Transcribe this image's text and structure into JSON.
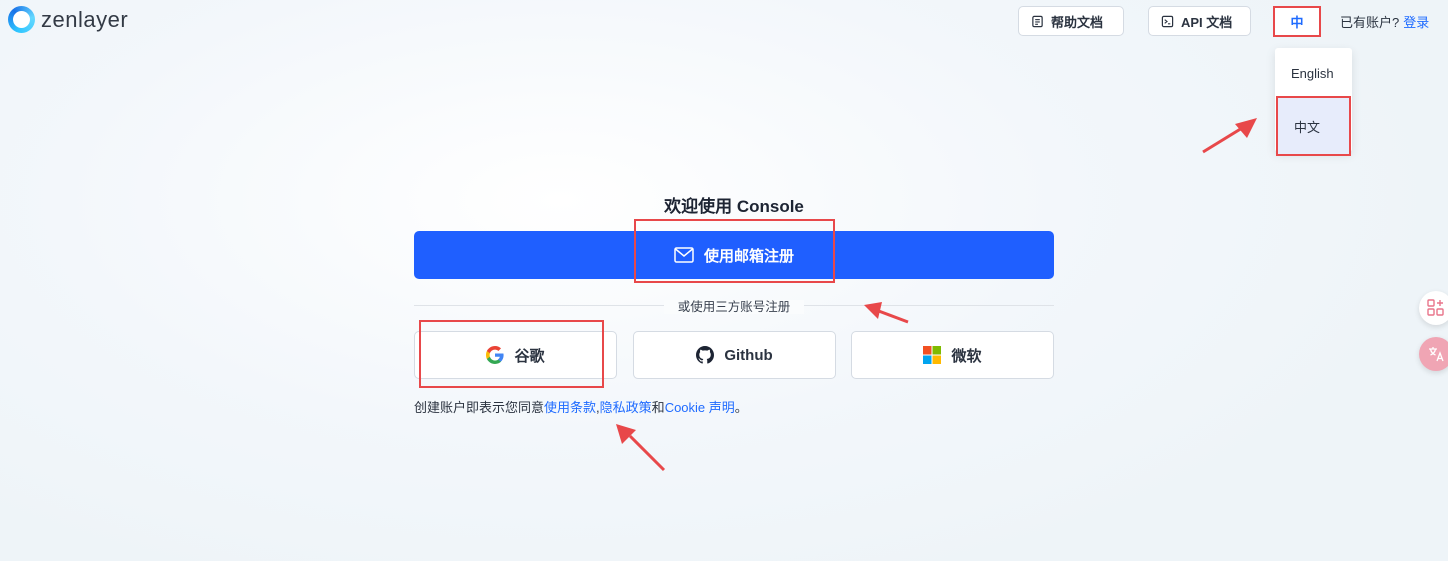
{
  "brand": {
    "name": "zenlayer"
  },
  "header": {
    "help_docs": "帮助文档",
    "api_docs": "API 文档",
    "lang_current": "中",
    "has_account": "已有账户?",
    "login": "登录"
  },
  "lang_menu": {
    "items": [
      "English",
      "中文"
    ]
  },
  "main": {
    "title": "欢迎使用 Console",
    "email_signup": "使用邮箱注册",
    "divider": "或使用三方账号注册",
    "oauth": {
      "google": "谷歌",
      "github": "Github",
      "microsoft": "微软"
    },
    "terms": {
      "prefix": "创建账户即表示您同意",
      "terms_link": "使用条款",
      "sep": ",",
      "privacy_link": "隐私政策",
      "and": "和",
      "cookie_link": "Cookie 声明",
      "end": "。"
    }
  },
  "colors": {
    "primary": "#1f5fff",
    "link": "#1f6bff",
    "annotation": "#e8484a"
  },
  "icons": [
    "document-icon",
    "terminal-icon",
    "mail-icon",
    "google-icon",
    "github-icon",
    "microsoft-icon",
    "apps-icon",
    "translate-icon"
  ]
}
